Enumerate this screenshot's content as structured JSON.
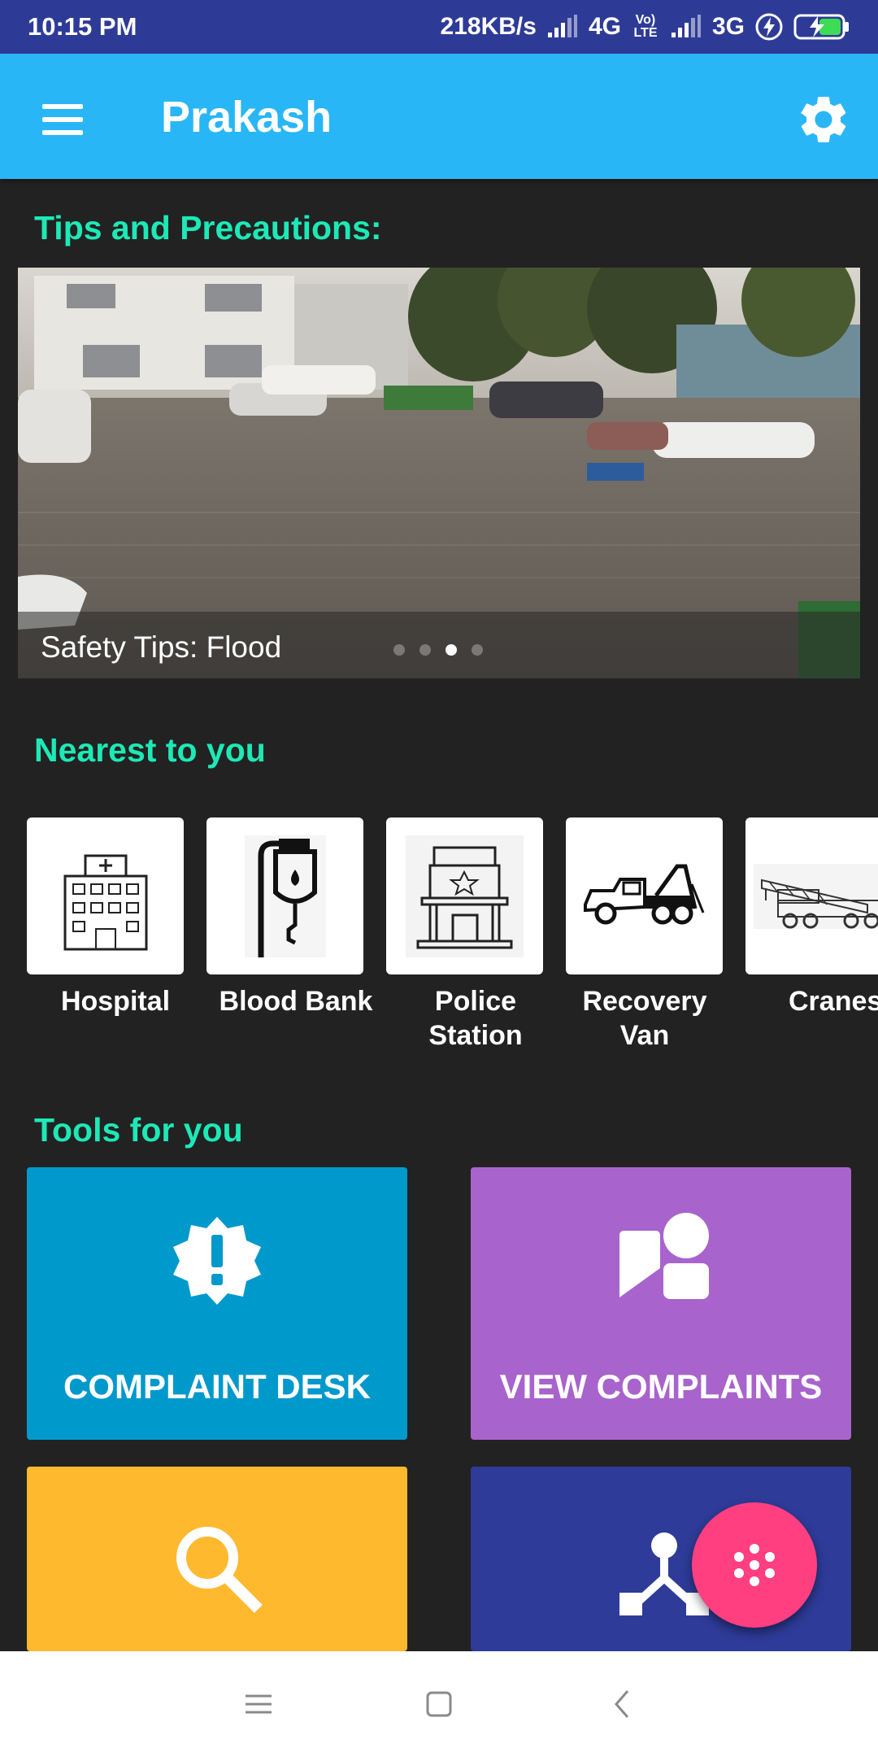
{
  "status_bar": {
    "time": "10:15 PM",
    "net_speed": "218KB/s",
    "network_1": "4G",
    "volte": "Vo) LTE",
    "network_2": "3G",
    "battery_icon": "battery-charging-icon"
  },
  "toolbar": {
    "title": "Prakash",
    "menu_icon": "hamburger-menu-icon",
    "settings_icon": "gear-icon",
    "background": "#29b6f6"
  },
  "sections": {
    "tips_title": "Tips and Precautions:",
    "nearest_title": "Nearest to you",
    "tools_title": "Tools for you"
  },
  "carousel": {
    "caption": "Safety Tips: Flood",
    "slide_count": 4,
    "active_index": 2
  },
  "nearest": [
    {
      "label": "Hospital",
      "icon": "hospital-icon"
    },
    {
      "label": "Blood Bank",
      "icon": "blood-bank-icon"
    },
    {
      "label": "Police Station",
      "icon": "police-station-icon"
    },
    {
      "label": "Recovery Van",
      "icon": "tow-truck-icon"
    },
    {
      "label": "Cranes",
      "icon": "crane-icon"
    }
  ],
  "tools": [
    {
      "label": "COMPLAINT DESK",
      "icon": "alert-badge-icon",
      "color": "#0099cc"
    },
    {
      "label": "VIEW COMPLAINTS",
      "icon": "shapes-icon",
      "color": "#a864cc"
    },
    {
      "label": "",
      "icon": "search-icon",
      "color": "#ffb92e"
    },
    {
      "label": "",
      "icon": "network-icon",
      "color": "#2e3b98"
    }
  ],
  "fab": {
    "icon": "dots-flower-icon",
    "color": "#ff3f7f"
  },
  "nav_bar": {
    "recents_icon": "recents-icon",
    "home_icon": "home-icon",
    "back_icon": "back-icon"
  }
}
